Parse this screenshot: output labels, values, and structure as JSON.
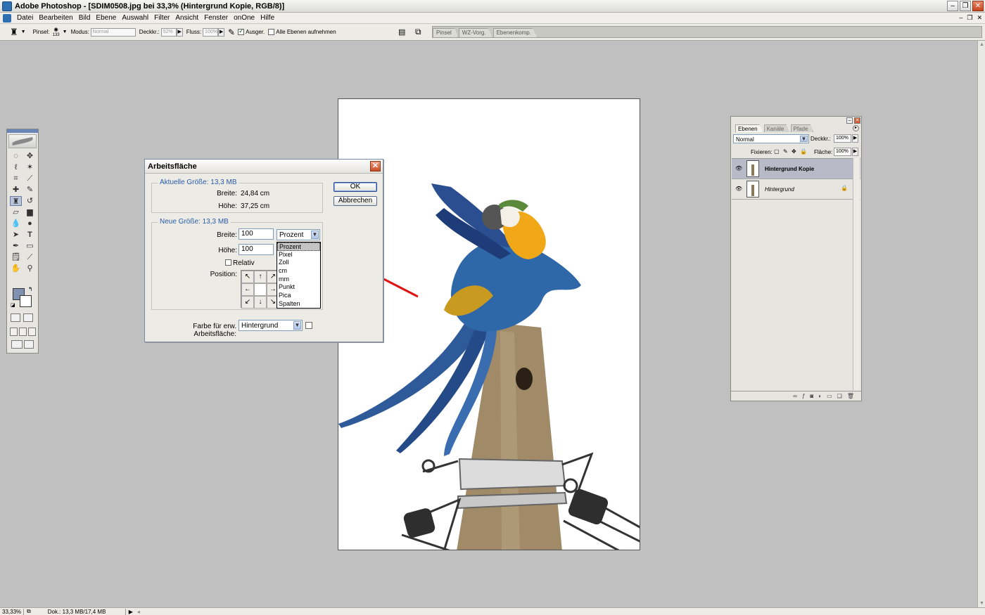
{
  "window": {
    "title": "Adobe Photoshop - [SDIM0508.jpg bei 33,3% (Hintergrund Kopie, RGB/8)]"
  },
  "menu": {
    "items": [
      "Datei",
      "Bearbeiten",
      "Bild",
      "Ebene",
      "Auswahl",
      "Filter",
      "Ansicht",
      "Fenster",
      "onOne",
      "Hilfe"
    ]
  },
  "options": {
    "pinsel_label": "Pinsel:",
    "brush_size": "133",
    "modus_label": "Modus:",
    "modus_value": "Normal",
    "deckkr_label": "Deckkr.:",
    "deckkr_value": "52%",
    "fluss_label": "Fluss:",
    "fluss_value": "100%",
    "ausger_label": "Ausger.",
    "alle_ebenen_label": "Alle Ebenen aufnehmen",
    "palette_tabs": [
      "Pinsel",
      "WZ-Vorg.",
      "Ebenenkomp."
    ]
  },
  "status": {
    "zoom": "33,33%",
    "doc": "Dok.: 13,3 MB/17,4 MB"
  },
  "dialog": {
    "title": "Arbeitsfläche",
    "ok_label": "OK",
    "cancel_label": "Abbrechen",
    "current_size_title": "Aktuelle Größe: 13,3 MB",
    "current_width_label": "Breite:",
    "current_width_value": "24,84 cm",
    "current_height_label": "Höhe:",
    "current_height_value": "37,25 cm",
    "new_size_title": "Neue Größe: 13,3 MB",
    "new_width_label": "Breite:",
    "new_width_value": "100",
    "new_height_label": "Höhe:",
    "new_height_value": "100",
    "unit_selected": "Prozent",
    "unit_options": [
      "Prozent",
      "Pixel",
      "Zoll",
      "cm",
      "mm",
      "Punkt",
      "Pica",
      "Spalten"
    ],
    "relative_label": "Relativ",
    "position_label": "Position:",
    "canvas_color_label": "Farbe für erw. Arbeitsfläche:",
    "canvas_color_value": "Hintergrund"
  },
  "layers_panel": {
    "tabs": [
      "Ebenen",
      "Kanäle",
      "Pfade"
    ],
    "blend_mode": "Normal",
    "opacity_label": "Deckkr.:",
    "opacity_value": "100%",
    "lock_label": "Fixieren:",
    "fill_label": "Fläche:",
    "fill_value": "100%",
    "layers": [
      {
        "name": "Hintergrund Kopie",
        "selected": true
      },
      {
        "name": "Hintergrund",
        "selected": false
      }
    ]
  },
  "colors": {
    "annotation_arrow": "#e01010",
    "selection": "#b8bac8"
  }
}
